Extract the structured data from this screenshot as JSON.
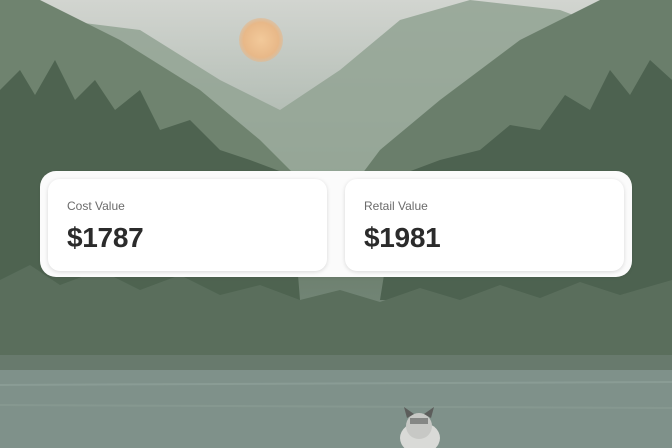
{
  "cards": [
    {
      "label": "Cost Value",
      "value": "$1787"
    },
    {
      "label": "Retail Value",
      "value": "$1981"
    }
  ],
  "colors": {
    "card_background": "#ffffff",
    "panel_background": "#fbfbfb",
    "label_text": "#6b6b6b",
    "value_text": "#2b2b2b"
  }
}
